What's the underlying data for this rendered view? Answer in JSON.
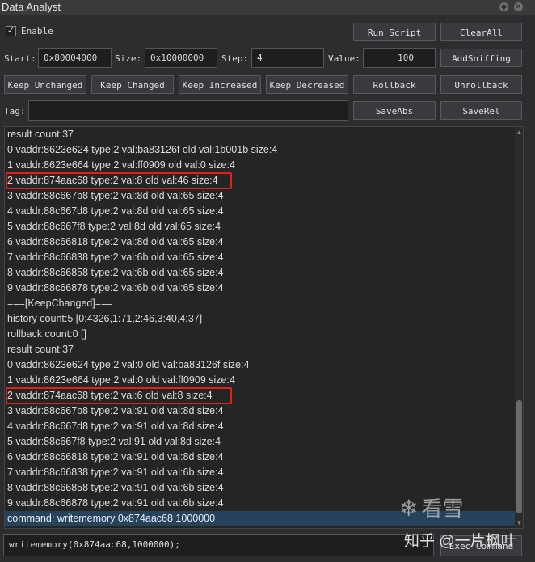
{
  "window": {
    "title": "Data Analyst"
  },
  "enable": {
    "label": "Enable",
    "checked": true
  },
  "toolbar": {
    "run_script": "Run Script",
    "clear_all": "ClearAll",
    "add_sniffing": "AddSniffing",
    "rollback": "Rollback",
    "unrollback": "Unrollback",
    "save_abs": "SaveAbs",
    "save_rel": "SaveRel"
  },
  "fields": {
    "start_label": "Start:",
    "start_value": "0x80004000",
    "size_label": "Size:",
    "size_value": "0x10000000",
    "step_label": "Step:",
    "step_value": "4",
    "value_label": "Value:",
    "value_value": "100",
    "tag_label": "Tag:",
    "tag_value": ""
  },
  "filters": {
    "keep_unchanged": "Keep Unchanged",
    "keep_changed": "Keep Changed",
    "keep_increased": "Keep Increased",
    "keep_decreased": "Keep Decreased"
  },
  "log": {
    "lines": [
      "result count:37",
      "0 vaddr:8623e624 type:2 val:ba83126f old val:1b001b size:4",
      "1 vaddr:8623e664 type:2 val:ff0909 old val:0 size:4",
      "2 vaddr:874aac68 type:2 val:8 old val:46 size:4",
      "3 vaddr:88c667b8 type:2 val:8d old val:65 size:4",
      "4 vaddr:88c667d8 type:2 val:8d old val:65 size:4",
      "5 vaddr:88c667f8 type:2 val:8d old val:65 size:4",
      "6 vaddr:88c66818 type:2 val:8d old val:65 size:4",
      "7 vaddr:88c66838 type:2 val:6b old val:65 size:4",
      "8 vaddr:88c66858 type:2 val:6b old val:65 size:4",
      "9 vaddr:88c66878 type:2 val:6b old val:65 size:4",
      "===[KeepChanged]===",
      "history count:5 [0:4326,1:71,2:46,3:40,4:37]",
      "rollback count:0 []",
      "result count:37",
      "0 vaddr:8623e624 type:2 val:0 old val:ba83126f size:4",
      "1 vaddr:8623e664 type:2 val:0 old val:ff0909 size:4",
      "2 vaddr:874aac68 type:2 val:6 old val:8 size:4",
      "3 vaddr:88c667b8 type:2 val:91 old val:8d size:4",
      "4 vaddr:88c667d8 type:2 val:91 old val:8d size:4",
      "5 vaddr:88c667f8 type:2 val:91 old val:8d size:4",
      "6 vaddr:88c66818 type:2 val:91 old val:8d size:4",
      "7 vaddr:88c66838 type:2 val:91 old val:6b size:4",
      "8 vaddr:88c66858 type:2 val:91 old val:6b size:4",
      "9 vaddr:88c66878 type:2 val:91 old val:6b size:4",
      "command: writememory 0x874aac68 1000000"
    ]
  },
  "command": {
    "input_value": "writememory(0x874aac68,1000000);",
    "exec_label": "Exec Command"
  },
  "watermark": {
    "kanxue": "看雪",
    "zhihu": "知乎 @一片枫叶"
  },
  "colors": {
    "highlight_box": "#e02020",
    "selected_line": "#27435c"
  }
}
